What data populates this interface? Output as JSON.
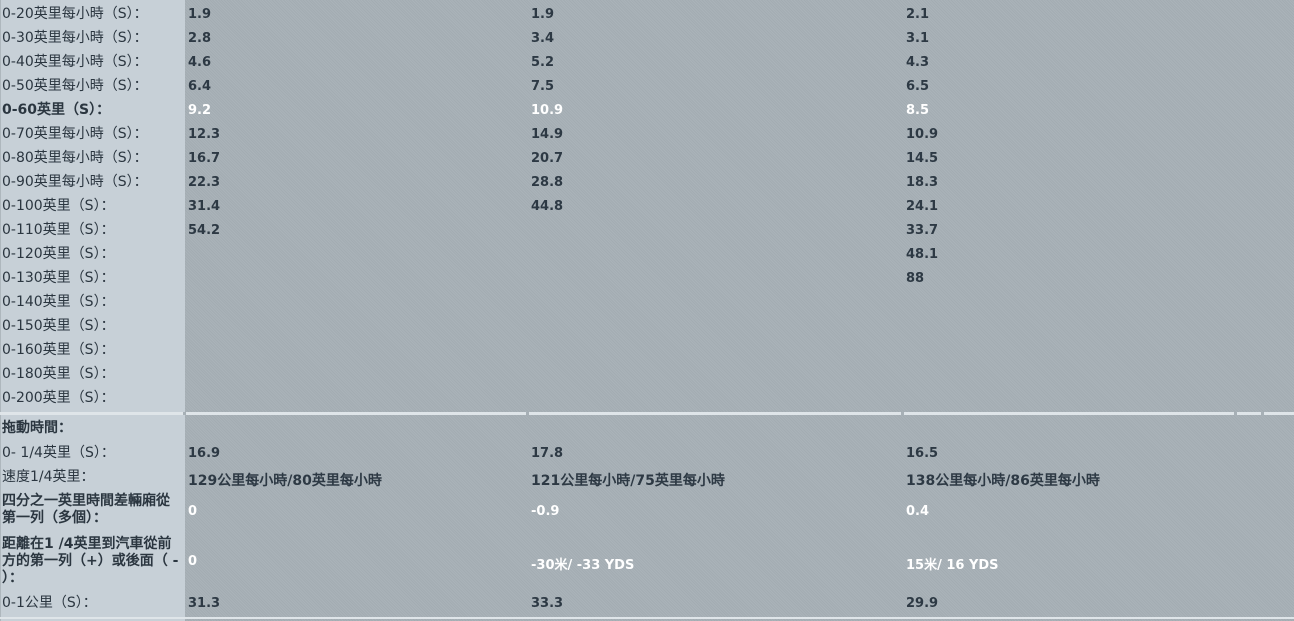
{
  "acceleration": [
    {
      "label": "0-20英里每小時（S）：",
      "v": [
        "1.9",
        "1.9",
        "2.1"
      ]
    },
    {
      "label": "0-30英里每小時（S）：",
      "v": [
        "2.8",
        "3.4",
        "3.1"
      ]
    },
    {
      "label": "0-40英里每小時（S）：",
      "v": [
        "4.6",
        "5.2",
        "4.3"
      ]
    },
    {
      "label": "0-50英里每小時（S）：",
      "v": [
        "6.4",
        "7.5",
        "6.5"
      ]
    },
    {
      "label": "0-60英里（S）：",
      "v": [
        "9.2",
        "10.9",
        "8.5"
      ]
    },
    {
      "label": "0-70英里每小時（S）：",
      "v": [
        "12.3",
        "14.9",
        "10.9"
      ]
    },
    {
      "label": "0-80英里每小時（S）：",
      "v": [
        "16.7",
        "20.7",
        "14.5"
      ]
    },
    {
      "label": "0-90英里每小時（S）：",
      "v": [
        "22.3",
        "28.8",
        "18.3"
      ]
    },
    {
      "label": "0-100英里（S）：",
      "v": [
        "31.4",
        "44.8",
        "24.1"
      ]
    },
    {
      "label": "0-110英里（S）：",
      "v": [
        "54.2",
        "",
        "33.7"
      ]
    },
    {
      "label": "0-120英里（S）：",
      "v": [
        "",
        "",
        "48.1"
      ]
    },
    {
      "label": "0-130英里（S）：",
      "v": [
        "",
        "",
        "88"
      ]
    },
    {
      "label": "0-140英里（S）：",
      "v": [
        "",
        "",
        ""
      ]
    },
    {
      "label": "0-150英里（S）：",
      "v": [
        "",
        "",
        ""
      ]
    },
    {
      "label": "0-160英里（S）：",
      "v": [
        "",
        "",
        ""
      ]
    },
    {
      "label": "0-180英里（S）：",
      "v": [
        "",
        "",
        ""
      ]
    },
    {
      "label": "0-200英里（S）：",
      "v": [
        "",
        "",
        ""
      ]
    }
  ],
  "drag": {
    "heading": "拖動時間：",
    "quarter_mile": {
      "label": "0- 1/4英里（S）：",
      "v": [
        "16.9",
        "17.8",
        "16.5"
      ]
    },
    "quarter_speed": {
      "label": "速度1/4英里：",
      "v": [
        "129公里每小時/80英里每小時",
        "121公里每小時/75英里每小時",
        "138公里每小時/86英里每小時"
      ]
    },
    "quarter_diff": {
      "label": "四分之一英里時間差輛廂從第一列（多個）：",
      "v": [
        "0",
        "-0.9",
        "0.4"
      ]
    },
    "quarter_dist": {
      "label": "距離在1 /4英里到汽車從前方的第一列（+）或後面（ - ）：",
      "v": [
        "0",
        "-30米/ -33 YDS",
        "15米/ 16 YDS"
      ]
    },
    "km": {
      "label": "0-1公里（S）：",
      "v": [
        "31.3",
        "33.3",
        "29.9"
      ]
    }
  }
}
